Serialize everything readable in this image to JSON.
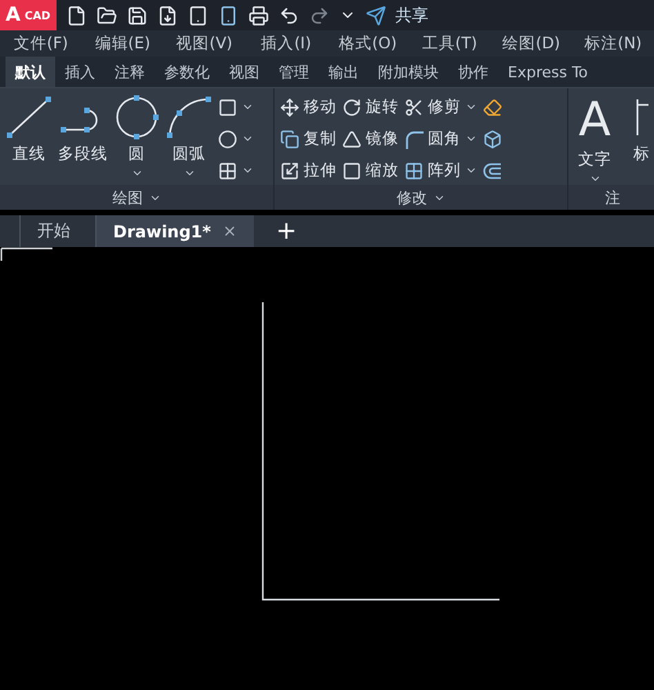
{
  "title_bar": {
    "logo_letter": "A",
    "logo_text": "CAD",
    "share": "共享"
  },
  "menu_bar": [
    "文件(F)",
    "编辑(E)",
    "视图(V)",
    "插入(I)",
    "格式(O)",
    "工具(T)",
    "绘图(D)",
    "标注(N)"
  ],
  "ribbon_tabs": [
    {
      "label": "默认",
      "selected": true
    },
    {
      "label": "插入",
      "selected": false
    },
    {
      "label": "注释",
      "selected": false
    },
    {
      "label": "参数化",
      "selected": false
    },
    {
      "label": "视图",
      "selected": false
    },
    {
      "label": "管理",
      "selected": false
    },
    {
      "label": "输出",
      "selected": false
    },
    {
      "label": "附加模块",
      "selected": false
    },
    {
      "label": "协作",
      "selected": false
    },
    {
      "label": "Express To",
      "selected": false
    }
  ],
  "ribbon_panels": [
    {
      "title": "绘图",
      "columns": [
        {
          "kind": "large",
          "items": [
            {
              "label": "直线",
              "dropdown": false
            }
          ]
        },
        {
          "kind": "large",
          "items": [
            {
              "label": "多段线",
              "dropdown": false
            }
          ]
        },
        {
          "kind": "large",
          "items": [
            {
              "label": "圆",
              "dropdown": true
            }
          ]
        },
        {
          "kind": "large",
          "items": [
            {
              "label": "圆弧",
              "dropdown": true
            }
          ]
        },
        {
          "kind": "small",
          "items": [
            {
              "dropdown": true
            },
            {
              "dropdown": true
            },
            {
              "dropdown": true
            }
          ]
        }
      ]
    },
    {
      "title": "修改",
      "columns": [
        {
          "kind": "small",
          "items": [
            {
              "label": "移动",
              "dropdown": false
            },
            {
              "label": "复制",
              "dropdown": false
            },
            {
              "label": "拉伸",
              "dropdown": false
            }
          ]
        },
        {
          "kind": "small",
          "items": [
            {
              "label": "旋转",
              "dropdown": false
            },
            {
              "label": "镜像",
              "dropdown": false
            },
            {
              "label": "缩放",
              "dropdown": false
            }
          ]
        },
        {
          "kind": "small",
          "items": [
            {
              "label": "修剪",
              "dropdown": true
            },
            {
              "label": "圆角",
              "dropdown": true
            },
            {
              "label": "阵列",
              "dropdown": true
            }
          ]
        },
        {
          "kind": "small",
          "items": [
            {
              "dropdown": false
            },
            {
              "dropdown": false
            },
            {
              "dropdown": false
            }
          ]
        }
      ]
    },
    {
      "title": "注",
      "columns": [
        {
          "kind": "large",
          "glyph": "A",
          "items": [
            {
              "label": "文字",
              "dropdown": true
            }
          ]
        },
        {
          "kind": "large",
          "items": [
            {
              "label": "标",
              "dropdown": false
            }
          ]
        }
      ]
    }
  ],
  "doc_tabs": [
    {
      "label": "开始",
      "selected": false,
      "closable": false
    },
    {
      "label": "Drawing1*",
      "selected": true,
      "closable": true
    }
  ],
  "new_tab": "+"
}
